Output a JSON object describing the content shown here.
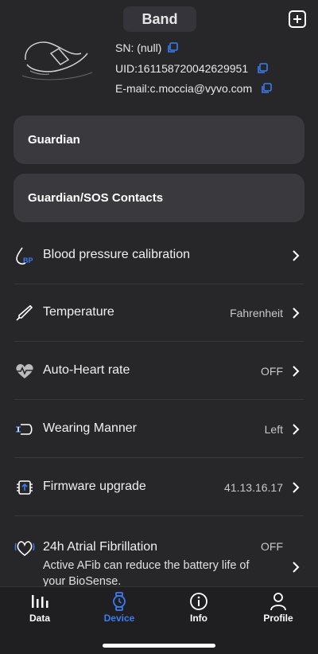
{
  "header": {
    "title": "Band"
  },
  "device_info": {
    "sn": "SN: (null)",
    "uid": "UID:161158720042629951",
    "email": "E-mail:c.moccia@vyvo.com"
  },
  "cards": [
    {
      "label": "Guardian"
    },
    {
      "label": "Guardian/SOS Contacts"
    }
  ],
  "settings": [
    {
      "label": "Blood pressure calibration",
      "value": "",
      "icon": "blood-pressure-icon"
    },
    {
      "label": "Temperature",
      "value": "Fahrenheit",
      "icon": "thermometer-icon"
    },
    {
      "label": "Auto-Heart rate",
      "value": "OFF",
      "icon": "heart-rate-icon"
    },
    {
      "label": "Wearing Manner",
      "value": "Left",
      "icon": "wristband-icon"
    },
    {
      "label": "Firmware upgrade",
      "value": "41.13.16.17",
      "icon": "chip-icon"
    },
    {
      "label": "24h Atrial Fibrillation",
      "value": "OFF",
      "icon": "afib-heart-icon",
      "description": "Active AFib can reduce the battery life of your BioSense."
    }
  ],
  "tabs": [
    {
      "label": "Data",
      "icon": "bar-chart-icon",
      "active": false
    },
    {
      "label": "Device",
      "icon": "watch-icon",
      "active": true
    },
    {
      "label": "Info",
      "icon": "info-icon",
      "active": false
    },
    {
      "label": "Profile",
      "icon": "person-icon",
      "active": false
    }
  ],
  "colors": {
    "accent": "#3b7cf0",
    "background": "#27272a",
    "card": "#3a3a3e"
  }
}
